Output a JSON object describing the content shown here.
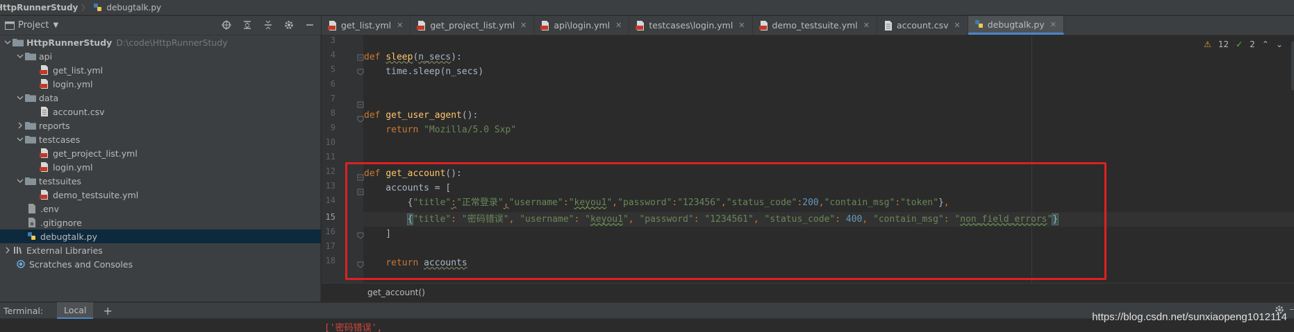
{
  "navbar": {
    "project_crumb": "HttpRunnerStudy",
    "file_crumb": "debugtalk.py"
  },
  "project_panel": {
    "title": "Project",
    "tree": [
      {
        "label": "HttpRunnerStudy",
        "hint": "D:\\code\\HttpRunnerStudy",
        "icon": "folder-icon"
      },
      {
        "label": "api",
        "icon": "folder-icon"
      },
      {
        "label": "get_list.yml",
        "icon": "yaml-file-icon"
      },
      {
        "label": "login.yml",
        "icon": "yaml-file-icon"
      },
      {
        "label": "data",
        "icon": "folder-icon"
      },
      {
        "label": "account.csv",
        "icon": "csv-file-icon"
      },
      {
        "label": "reports",
        "icon": "folder-icon"
      },
      {
        "label": "testcases",
        "icon": "folder-icon"
      },
      {
        "label": "get_project_list.yml",
        "icon": "yaml-file-icon"
      },
      {
        "label": "login.yml",
        "icon": "yaml-file-icon"
      },
      {
        "label": "testsuites",
        "icon": "folder-icon"
      },
      {
        "label": "demo_testsuite.yml",
        "icon": "yaml-file-icon"
      },
      {
        "label": ".env",
        "icon": "text-file-icon"
      },
      {
        "label": ".gitignore",
        "icon": "gitignore-file-icon"
      },
      {
        "label": "debugtalk.py",
        "icon": "python-file-icon"
      },
      {
        "label": "External Libraries",
        "icon": "library-icon"
      },
      {
        "label": "Scratches and Consoles",
        "icon": "scratches-icon"
      }
    ]
  },
  "tabs": [
    {
      "label": "get_list.yml",
      "icon": "yaml-file-icon"
    },
    {
      "label": "get_project_list.yml",
      "icon": "yaml-file-icon"
    },
    {
      "label": "api\\login.yml",
      "icon": "yaml-file-icon"
    },
    {
      "label": "testcases\\login.yml",
      "icon": "yaml-file-icon"
    },
    {
      "label": "demo_testsuite.yml",
      "icon": "yaml-file-icon"
    },
    {
      "label": "account.csv",
      "icon": "csv-file-icon"
    },
    {
      "label": "debugtalk.py",
      "icon": "python-file-icon",
      "active": true
    }
  ],
  "editor": {
    "line_numbers": [
      "3",
      "4",
      "5",
      "6",
      "7",
      "8",
      "9",
      "10",
      "11",
      "12",
      "13",
      "14",
      "15",
      "16",
      "17",
      "18"
    ],
    "current_line": "15",
    "inspections": {
      "warnings": "12",
      "typos": "2"
    }
  },
  "breadcrumb": {
    "function": "get_account()"
  },
  "terminal": {
    "label": "Terminal:",
    "tab": "Local",
    "add": "+",
    "output": "['密码错误',"
  },
  "watermark": "https://blog.csdn.net/sunxiaopeng1012114",
  "colors": {
    "highlight_box": "#e02020",
    "accent": "#4a88c7",
    "selection": "#0d293e"
  }
}
